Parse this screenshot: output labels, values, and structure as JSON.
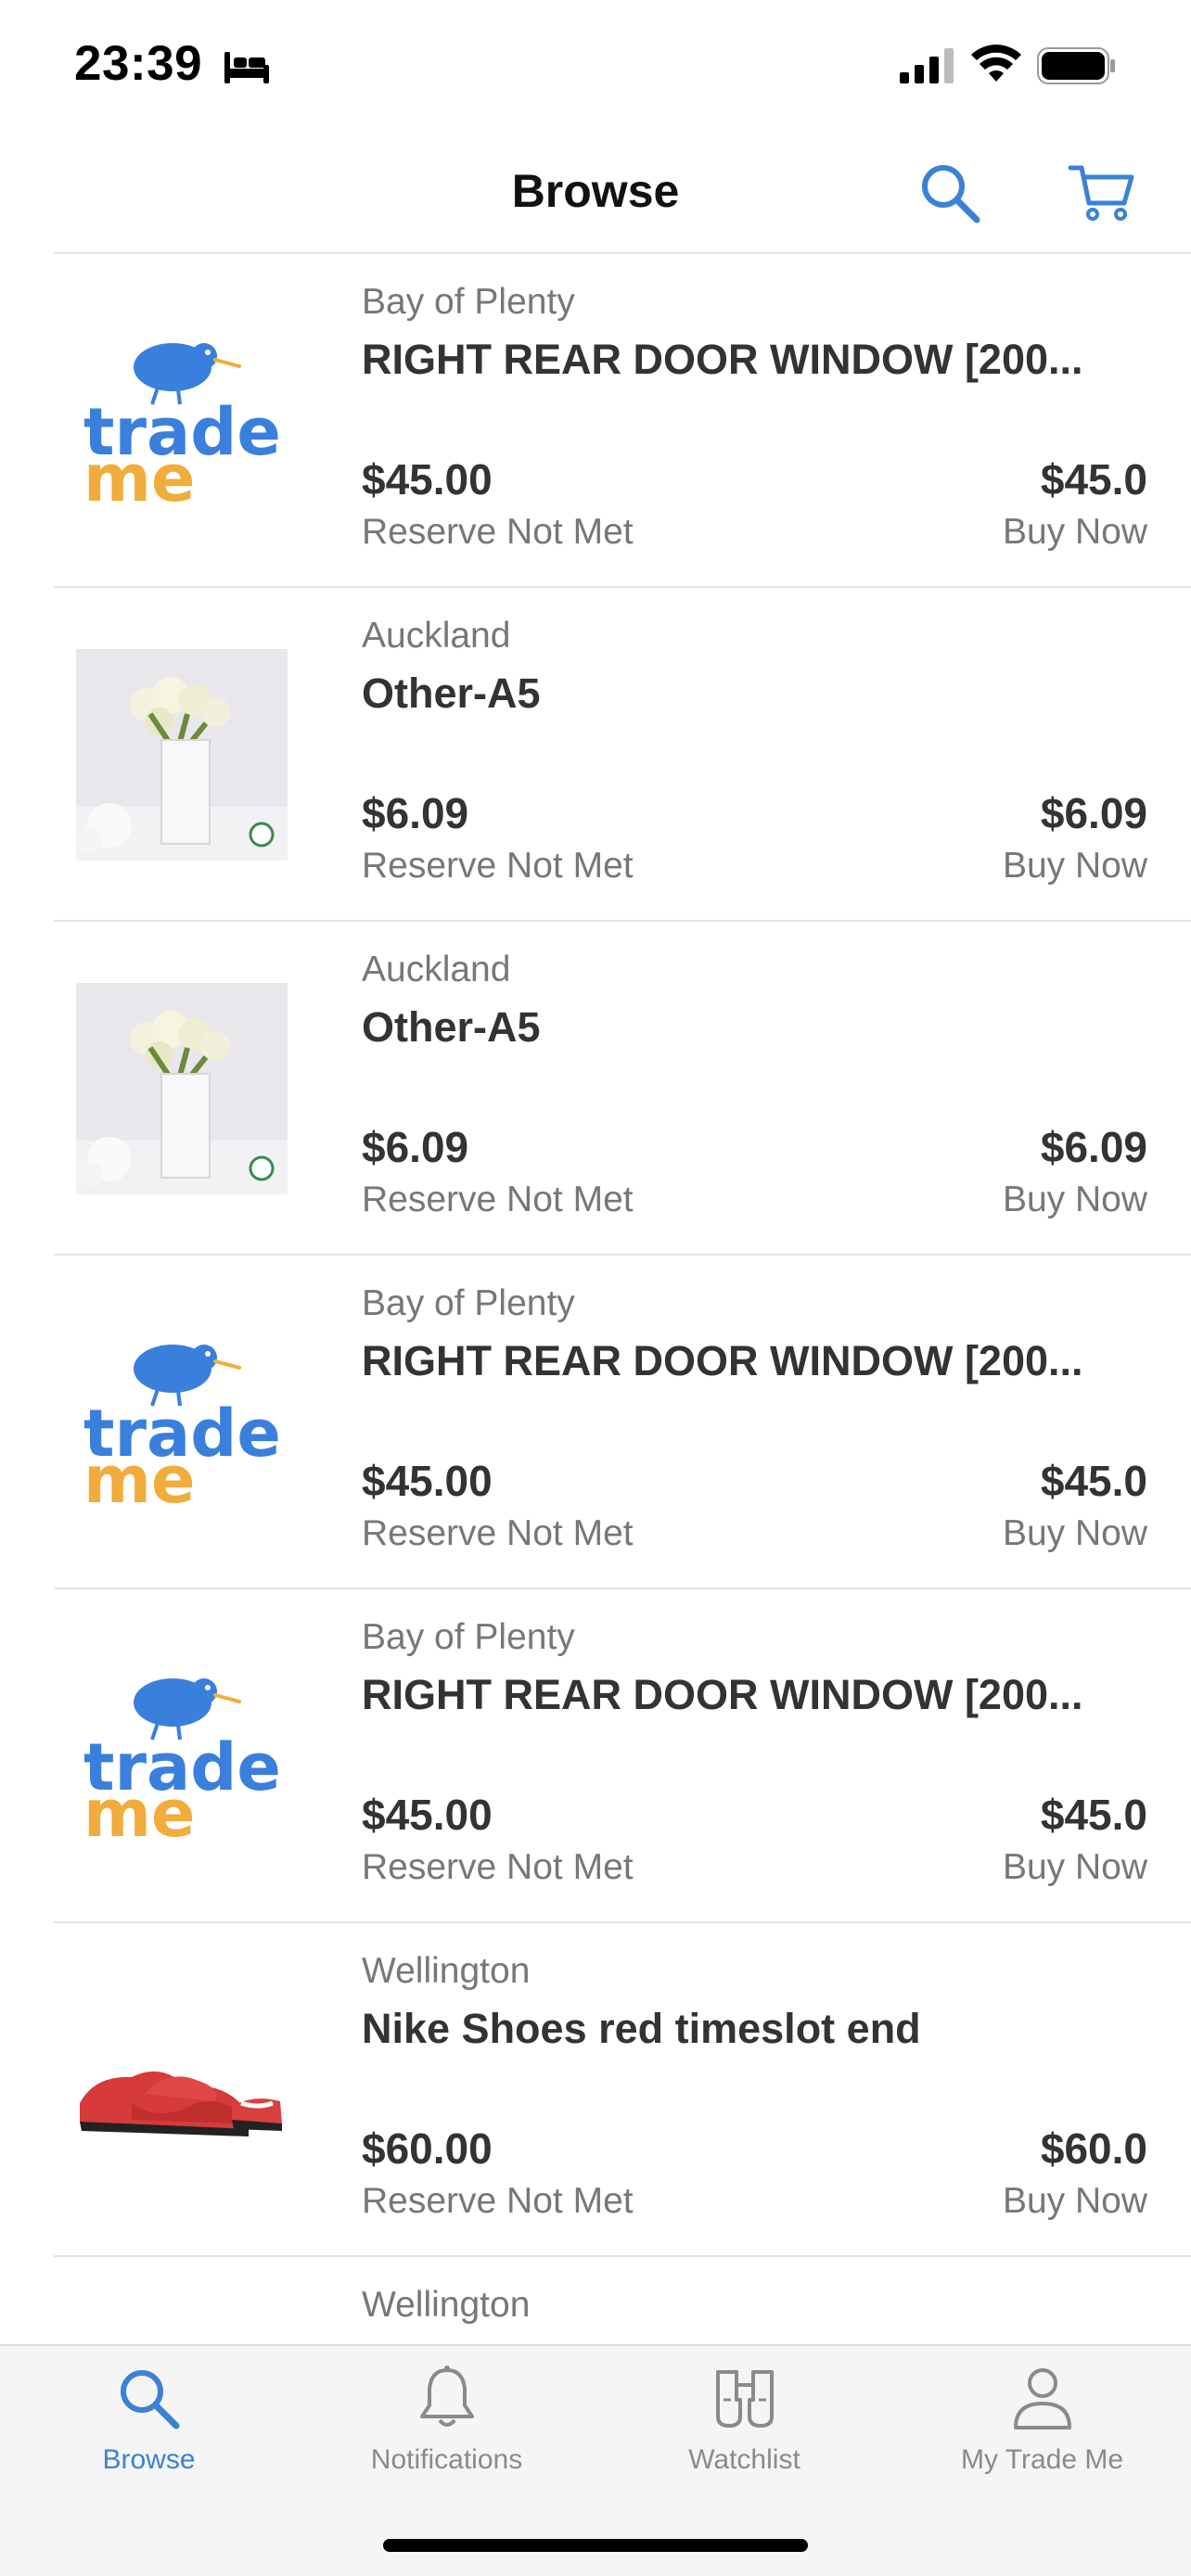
{
  "status_bar": {
    "time": "23:39"
  },
  "nav": {
    "title": "Browse"
  },
  "listings": [
    {
      "thumb": "trade-me-logo",
      "region": "Bay of Plenty",
      "title": "RIGHT REAR DOOR WINDOW [200...",
      "price": "$45.00",
      "price_label": "Reserve Not Met",
      "buy_price": "$45.0",
      "buy_label": "Buy Now"
    },
    {
      "thumb": "vase-photo",
      "region": "Auckland",
      "title": "Other-A5",
      "price": "$6.09",
      "price_label": "Reserve Not Met",
      "buy_price": "$6.09",
      "buy_label": "Buy Now"
    },
    {
      "thumb": "vase-photo",
      "region": "Auckland",
      "title": "Other-A5",
      "price": "$6.09",
      "price_label": "Reserve Not Met",
      "buy_price": "$6.09",
      "buy_label": "Buy Now"
    },
    {
      "thumb": "trade-me-logo",
      "region": "Bay of Plenty",
      "title": "RIGHT REAR DOOR WINDOW [200...",
      "price": "$45.00",
      "price_label": "Reserve Not Met",
      "buy_price": "$45.0",
      "buy_label": "Buy Now"
    },
    {
      "thumb": "trade-me-logo",
      "region": "Bay of Plenty",
      "title": "RIGHT REAR DOOR WINDOW [200...",
      "price": "$45.00",
      "price_label": "Reserve Not Met",
      "buy_price": "$45.0",
      "buy_label": "Buy Now"
    },
    {
      "thumb": "shoe-photo",
      "region": "Wellington",
      "title": "Nike Shoes red timeslot end",
      "price": "$60.00",
      "price_label": "Reserve Not Met",
      "buy_price": "$60.0",
      "buy_label": "Buy Now"
    },
    {
      "thumb": "red-object-photo",
      "region": "Wellington",
      "title": "",
      "price": "",
      "price_label": "",
      "buy_price": "",
      "buy_label": ""
    }
  ],
  "tabs": [
    {
      "label": "Browse",
      "icon": "search-icon",
      "active": true
    },
    {
      "label": "Notifications",
      "icon": "bell-icon",
      "active": false
    },
    {
      "label": "Watchlist",
      "icon": "binoculars-icon",
      "active": false
    },
    {
      "label": "My Trade Me",
      "icon": "person-icon",
      "active": false
    }
  ],
  "colors": {
    "accent": "#3b82d6",
    "logo_blue": "#3a7fdc",
    "logo_yellow": "#f0ad3c",
    "text": "#333333",
    "secondary_text": "#777777"
  }
}
